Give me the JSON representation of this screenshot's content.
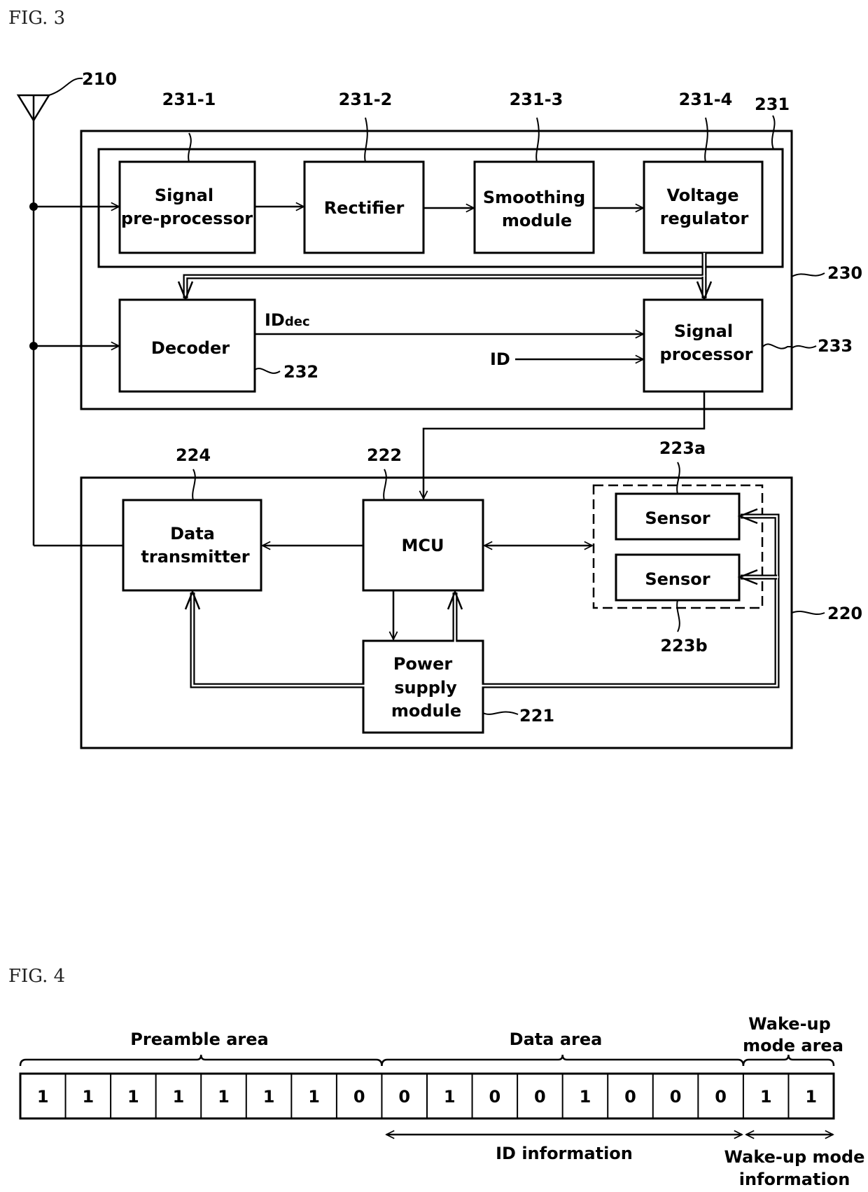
{
  "fig3": {
    "title": "FIG. 3",
    "antenna": {
      "ref": "210"
    },
    "receiver_module": {
      "ref": "230"
    },
    "power_chain": {
      "ref": "231"
    },
    "blocks": {
      "signal_preprocessor": {
        "line1": "Signal",
        "line2": "pre-processor",
        "ref": "231-1"
      },
      "rectifier": {
        "line1": "Rectifier",
        "ref": "231-2"
      },
      "smoothing_module": {
        "line1": "Smoothing",
        "line2": "module",
        "ref": "231-3"
      },
      "voltage_regulator": {
        "line1": "Voltage",
        "line2": "regulator",
        "ref": "231-4"
      },
      "decoder": {
        "line1": "Decoder",
        "ref": "232"
      },
      "signal_processor": {
        "line1": "Signal",
        "line2": "processor",
        "ref": "233"
      },
      "data_transmitter": {
        "line1": "Data",
        "line2": "transmitter",
        "ref": "224"
      },
      "mcu": {
        "line1": "MCU",
        "ref": "222"
      },
      "sensor_a": {
        "line1": "Sensor",
        "ref": "223a"
      },
      "sensor_b": {
        "line1": "Sensor",
        "ref": "223b"
      },
      "power_supply": {
        "line1": "Power",
        "line2": "supply",
        "line3": "module",
        "ref": "221"
      }
    },
    "signals": {
      "id_dec_main": "ID",
      "id_dec_sub": "dec",
      "id": "ID"
    },
    "sensor_node": {
      "ref": "220"
    }
  },
  "fig4": {
    "title": "FIG. 4",
    "areas": {
      "preamble": "Preamble area",
      "data": "Data area",
      "wakeup_line1": "Wake-up",
      "wakeup_line2": "mode area"
    },
    "bits": [
      "1",
      "1",
      "1",
      "1",
      "1",
      "1",
      "1",
      "0",
      "0",
      "1",
      "0",
      "0",
      "1",
      "0",
      "0",
      "0",
      "1",
      "1"
    ],
    "spans": {
      "id_info": "ID information",
      "wakeup_info_line1": "Wake-up mode",
      "wakeup_info_line2": "information"
    }
  }
}
